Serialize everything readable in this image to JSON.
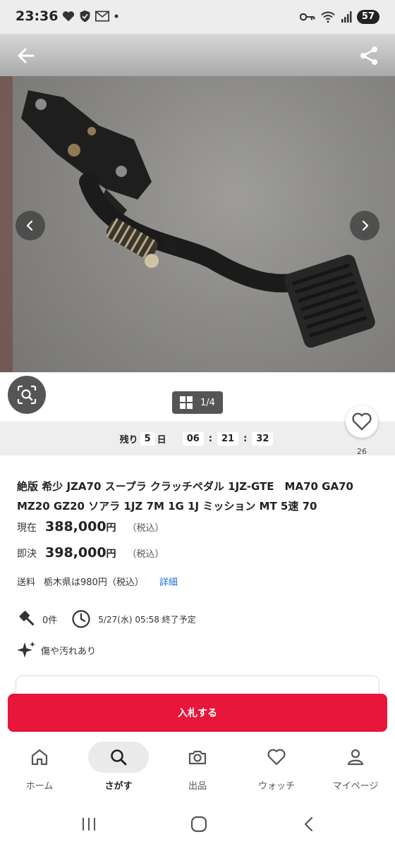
{
  "status_bar": {
    "time": "23:36",
    "battery": "57"
  },
  "gallery": {
    "counter": "1/4"
  },
  "timer": {
    "prefix": "残り",
    "days": "5",
    "day_unit": "日",
    "hours": "06",
    "minutes": "21",
    "seconds": "32"
  },
  "watch": {
    "count": "26"
  },
  "item": {
    "title": "絶版 希少 JZA70 スープラ クラッチペダル 1JZ-GTE　MA70 GA70 MZ20 GZ20 ソアラ 1JZ 7M 1G 1J ミッション MT 5速 70",
    "current_label": "現在",
    "current_price": "388,000",
    "current_yen": "円",
    "current_tax": "（税込）",
    "buyout_label": "即決",
    "buyout_price": "398,000",
    "buyout_yen": "円",
    "buyout_tax": "（税込）",
    "shipping_label": "送料",
    "shipping_value": "栃木県は980円（税込）",
    "shipping_detail": "詳細",
    "bids": "0件",
    "end_time": "5/27(水) 05:58 終了予定",
    "condition": "傷や汚れあり"
  },
  "actions": {
    "bid_button": "入札する"
  },
  "bottom_nav": {
    "items": [
      {
        "label": "ホーム",
        "icon": "home-icon"
      },
      {
        "label": "さがす",
        "icon": "search-icon"
      },
      {
        "label": "出品",
        "icon": "camera-icon"
      },
      {
        "label": "ウォッチ",
        "icon": "heart-icon"
      },
      {
        "label": "マイページ",
        "icon": "person-icon"
      }
    ],
    "active_index": 1
  },
  "colors": {
    "accent": "#e8163b",
    "link": "#1a6ad6"
  }
}
